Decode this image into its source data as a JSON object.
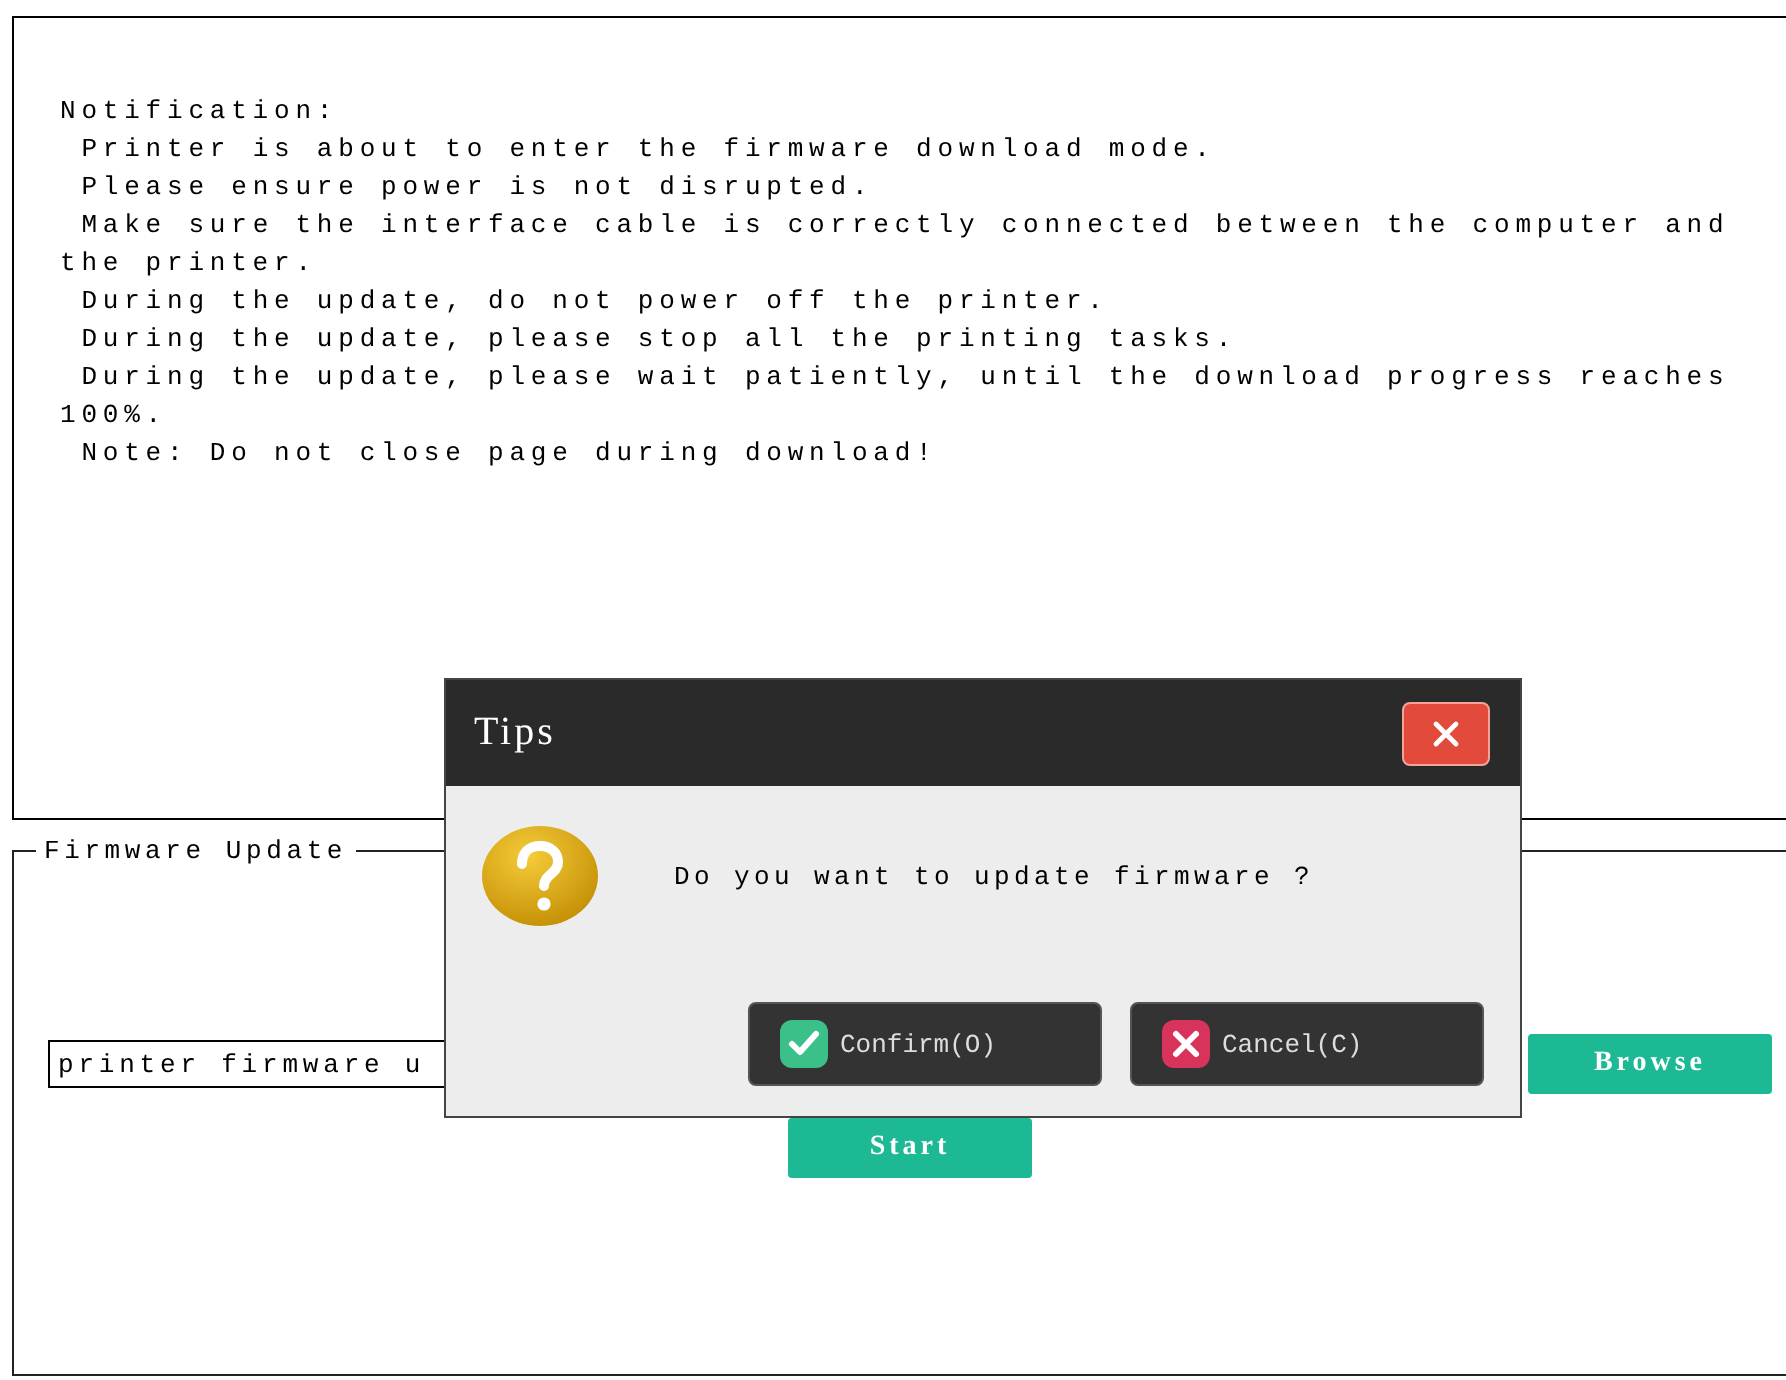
{
  "notification": {
    "lines": [
      "Notification:",
      " Printer is about to enter the firmware download mode.",
      " Please ensure power is not disrupted.",
      " Make sure the interface cable is correctly connected between the computer and the printer.",
      " During the update, do not power off the printer.",
      " During the update, please stop all the printing tasks.",
      " During the update, please wait patiently, until the download progress reaches 100%.",
      " Note: Do not close page during download!"
    ]
  },
  "firmware_update": {
    "legend": "Firmware Update",
    "file_field": {
      "value": "printer firmware u"
    },
    "browse_button": "Browse",
    "start_button": "Start"
  },
  "dialog": {
    "title": "Tips",
    "message": "Do you want to update firmware ?",
    "buttons": [
      {
        "kind": "confirm",
        "label": "Confirm(O)"
      },
      {
        "kind": "cancel",
        "label": "Cancel(C)"
      }
    ]
  }
}
